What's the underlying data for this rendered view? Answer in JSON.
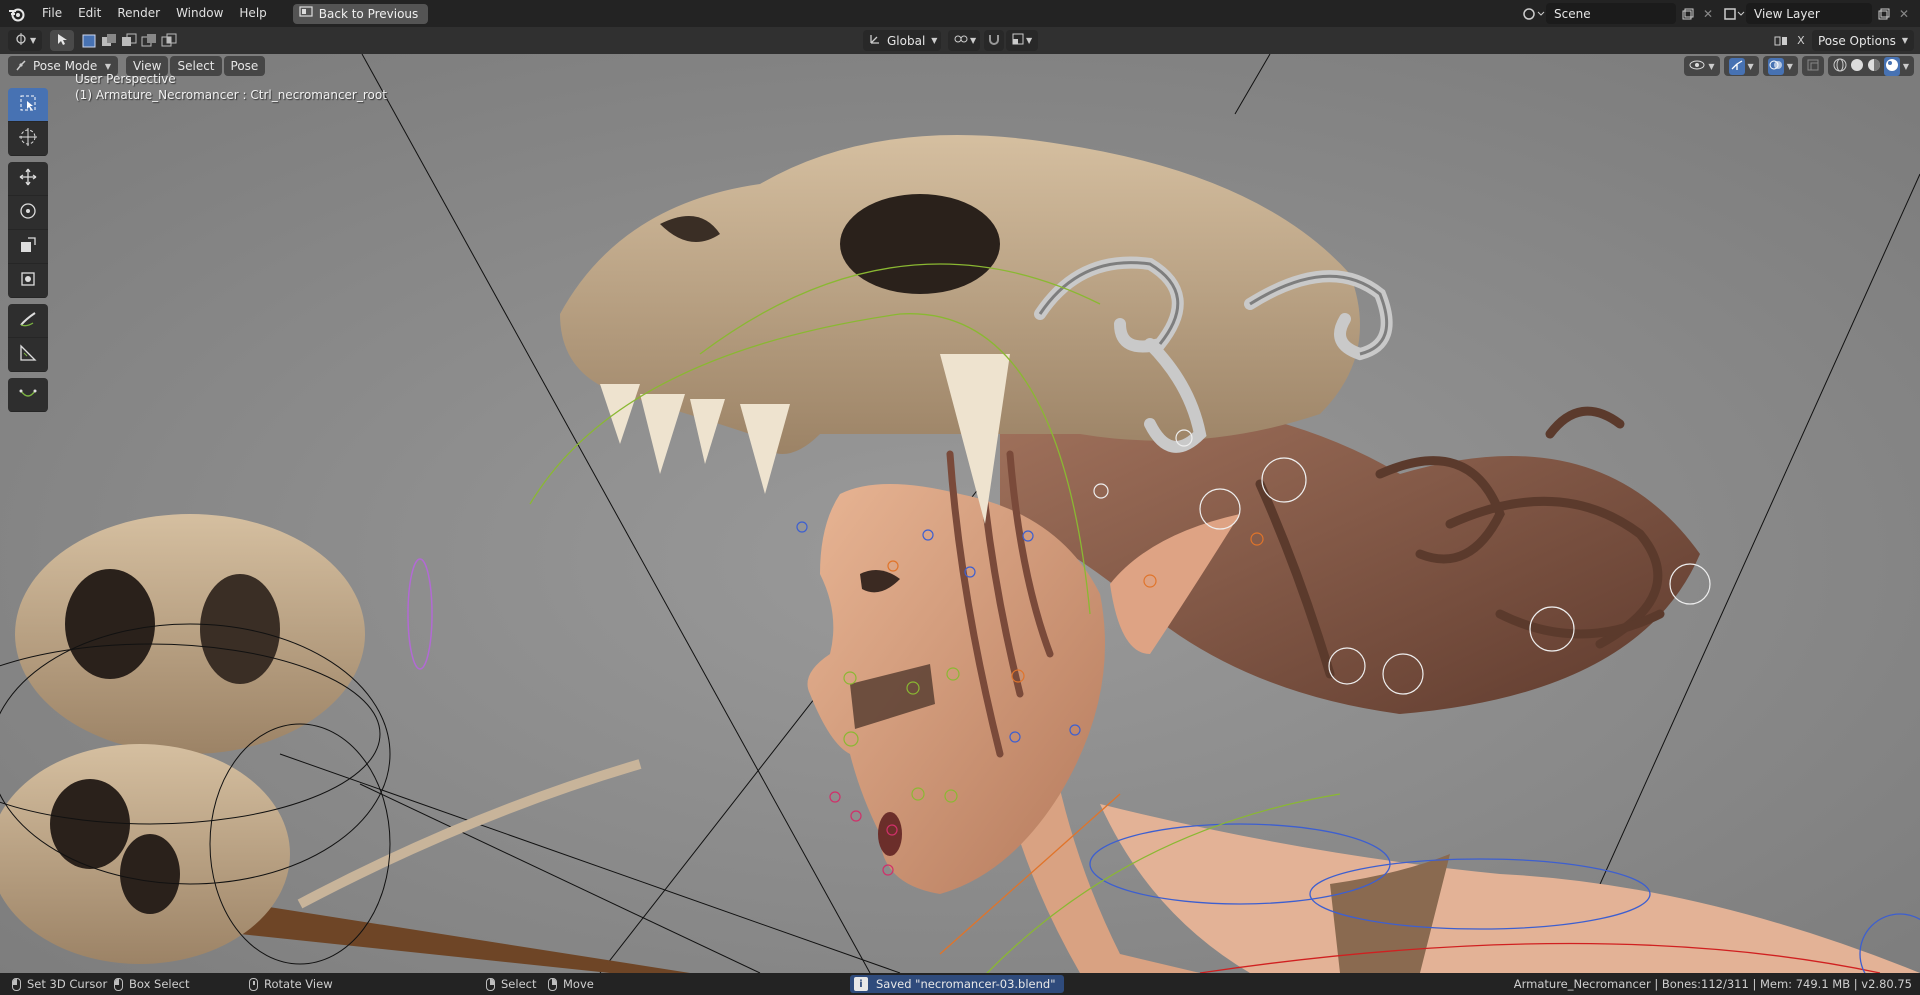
{
  "menu": {
    "items": [
      "File",
      "Edit",
      "Render",
      "Window",
      "Help"
    ],
    "back_button": "Back to Previous"
  },
  "scene": {
    "name": "Scene",
    "view_layer": "View Layer"
  },
  "header": {
    "transform_orientation": "Global",
    "pose_options": "Pose Options"
  },
  "viewport": {
    "mode": "Pose Mode",
    "menus": [
      "View",
      "Select",
      "Pose"
    ],
    "perspective_label": "User Perspective",
    "active_object": "(1) Armature_Necromancer : Ctrl_necromancer_root"
  },
  "statusbar": {
    "hints": [
      "Set 3D Cursor",
      "Box Select",
      "Rotate View",
      "Select",
      "Move"
    ],
    "message": "Saved \"necromancer-03.blend\"",
    "stats": "Armature_Necromancer | Bones:112/311 | Mem: 749.1 MB | v2.80.75"
  },
  "colors": {
    "accent": "#4772b3",
    "viewport_bg": "#868686",
    "header": "#303030",
    "topbar": "#232323"
  },
  "icons": [
    "blender-logo-icon",
    "select-box-icon",
    "cursor-icon",
    "move-icon",
    "rotate-icon",
    "scale-icon",
    "transform-icon",
    "annotate-icon",
    "measure-icon",
    "bone-icon"
  ]
}
